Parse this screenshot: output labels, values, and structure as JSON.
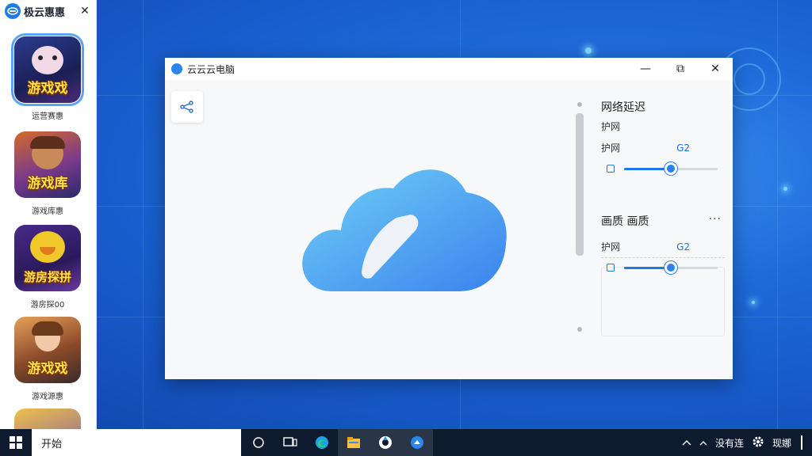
{
  "sidebar": {
    "app_title": "极云惠惠",
    "close_glyph": "✕",
    "games": [
      {
        "tile_title": "游戏戏",
        "label": "运营赛惠",
        "selected": true
      },
      {
        "tile_title": "游戏库",
        "label": "游戏库惠",
        "selected": false
      },
      {
        "tile_title": "游房探拼",
        "label": "游房探00",
        "selected": false
      },
      {
        "tile_title": "游戏戏",
        "label": "游戏源惠",
        "selected": false
      }
    ]
  },
  "window": {
    "title": "云云云电脑",
    "minimize_glyph": "—",
    "maximize_glyph": "⧉",
    "close_glyph": "✕",
    "network": {
      "title": "网络延迟",
      "subtitle": "护网",
      "row_label": "护网",
      "row_value": "G2",
      "slider_percent": 50
    },
    "quality": {
      "title": "画质  画质",
      "more_glyph": "···",
      "row_label": "护网",
      "row_value": "G2",
      "slider_percent": 50
    }
  },
  "taskbar": {
    "search_text": "开始",
    "tray_text_1": "没有连",
    "tray_text_2": "现娜",
    "icons": [
      "windows-icon",
      "cortana-icon",
      "task-view-icon",
      "edge-icon",
      "file-explorer-icon",
      "app-icon",
      "cloud-app-icon"
    ]
  },
  "colors": {
    "accent": "#1e78e6",
    "desktop": "#1d6ad9",
    "taskbar": "#0e1b2e"
  }
}
